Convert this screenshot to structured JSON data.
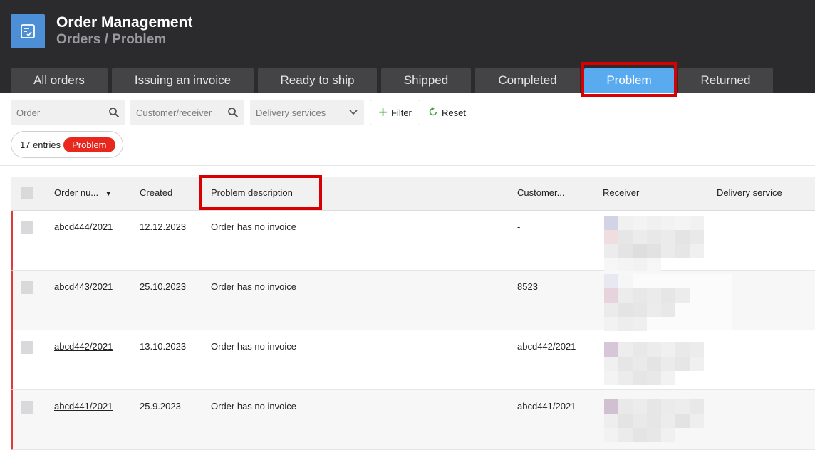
{
  "header": {
    "title": "Order Management",
    "breadcrumb": "Orders / Problem"
  },
  "tabs": [
    {
      "label": "All orders",
      "active": false
    },
    {
      "label": "Issuing an invoice",
      "active": false
    },
    {
      "label": "Ready to ship",
      "active": false
    },
    {
      "label": "Shipped",
      "active": false
    },
    {
      "label": "Completed",
      "active": false
    },
    {
      "label": "Problem",
      "active": true
    },
    {
      "label": "Returned",
      "active": false
    }
  ],
  "toolbar": {
    "order_placeholder": "Order",
    "customer_placeholder": "Customer/receiver",
    "delivery_placeholder": "Delivery services",
    "filter_label": "Filter",
    "reset_label": "Reset",
    "entries_text": "17 entries",
    "status_badge": "Problem"
  },
  "table": {
    "columns": [
      "Order nu...",
      "Created",
      "Problem description",
      "Customer...",
      "Receiver",
      "Delivery service"
    ],
    "rows": [
      {
        "order": "abcd444/2021",
        "created": "12.12.2023",
        "problem": "Order has no invoice",
        "customer": "-"
      },
      {
        "order": "abcd443/2021",
        "created": "25.10.2023",
        "problem": "Order has no invoice",
        "customer": "8523"
      },
      {
        "order": "abcd442/2021",
        "created": "13.10.2023",
        "problem": "Order has no invoice",
        "customer": "abcd442/2021"
      },
      {
        "order": "abcd441/2021",
        "created": "25.9.2023",
        "problem": "Order has no invoice",
        "customer": "abcd441/2021"
      }
    ]
  },
  "colors": {
    "header_bg": "#2b2b2e",
    "active_tab": "#5aaaf0",
    "highlight": "#d80000",
    "problem_badge": "#e8281f"
  }
}
